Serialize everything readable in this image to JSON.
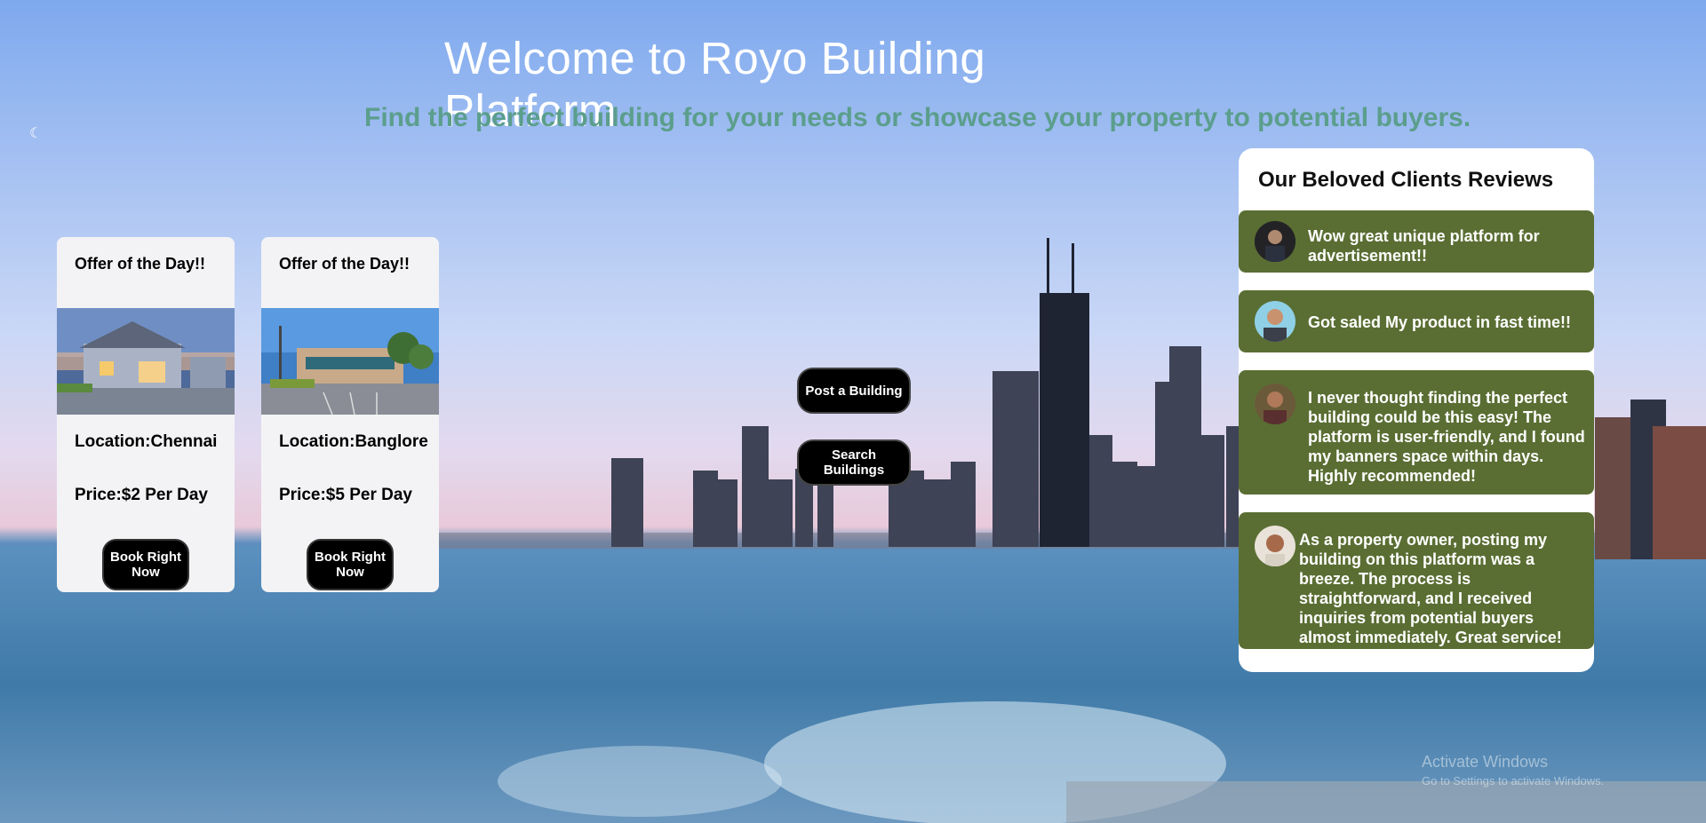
{
  "header": {
    "title": "Welcome to Royo Building Platform",
    "subtitle": "Find the perfect building for your needs or showcase your property to potential buyers."
  },
  "offers": [
    {
      "title": "Offer of the Day!!",
      "location": "Location:Chennai",
      "price": "Price:$2 Per Day",
      "button": "Book Right Now",
      "image": "house-photo"
    },
    {
      "title": "Offer of the Day!!",
      "location": "Location:Banglore",
      "price": "Price:$5 Per Day",
      "button": "Book Right Now",
      "image": "office-building-photo"
    }
  ],
  "actions": {
    "post_label": "Post a Building",
    "search_label": "Search Buildings"
  },
  "reviews": {
    "title": "Our Beloved Clients Reviews",
    "items": [
      {
        "text": "Wow great unique platform for advertisement!!"
      },
      {
        "text": "Got saled My product in fast time!!"
      },
      {
        "text": "I never thought finding the perfect building could be this easy! The platform is user-friendly, and I found my banners space within days. Highly recommended!"
      },
      {
        "text": "As a property owner, posting my building on this platform was a breeze. The process is straightforward, and I received inquiries from potential buyers almost immediately. Great service!"
      }
    ]
  },
  "watermark": {
    "line1": "Activate Windows",
    "line2": "Go to Settings to activate Windows."
  },
  "colors": {
    "review_bg": "#5a6e33",
    "subtitle": "#5b9e8c",
    "button_bg": "#000000"
  }
}
